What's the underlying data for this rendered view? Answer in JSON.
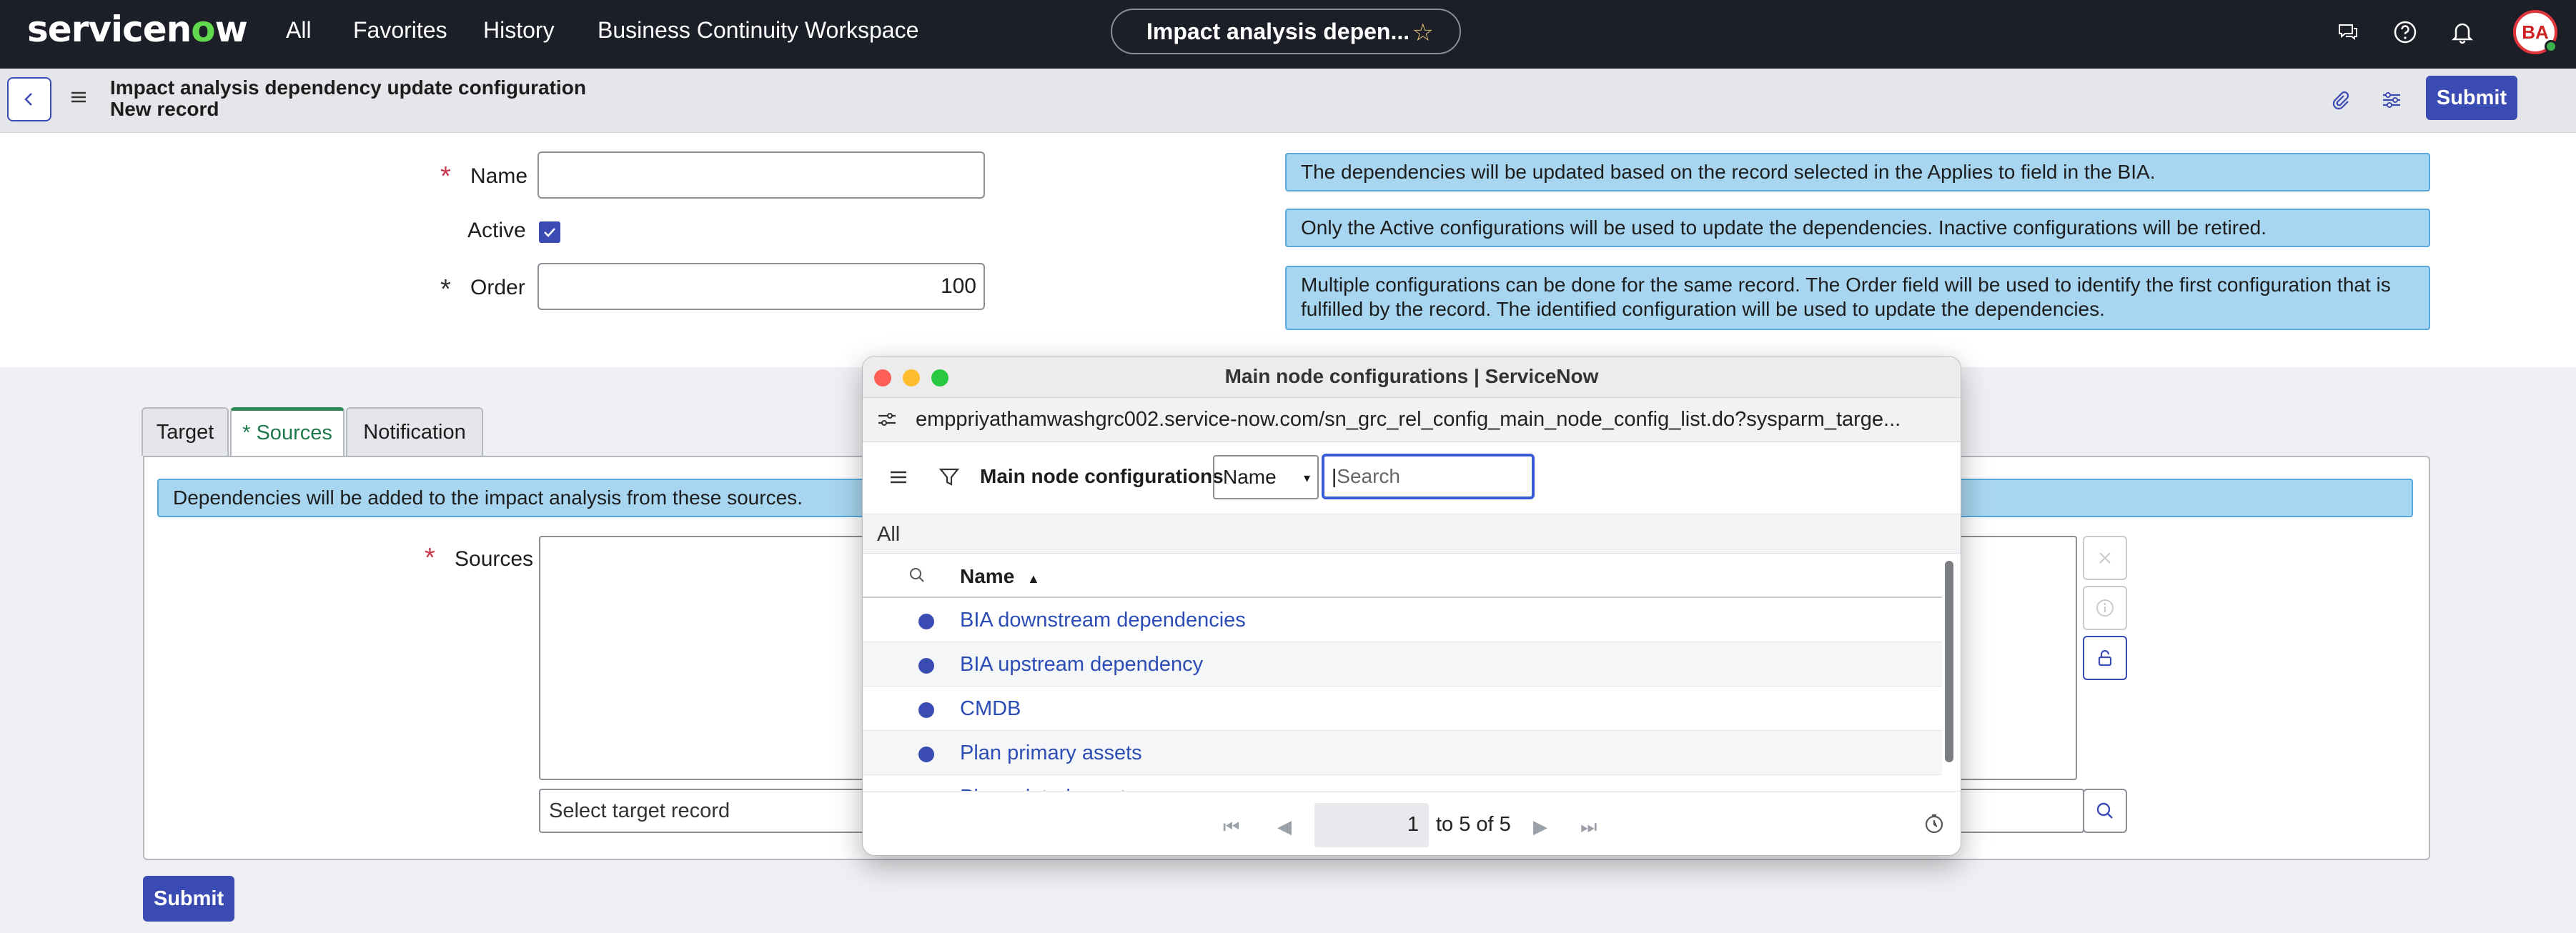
{
  "topnav": {
    "logo": "servicenow",
    "items": [
      "All",
      "Favorites",
      "History",
      "Business Continuity Workspace"
    ],
    "pill_title": "Impact analysis depen...",
    "avatar": "BA"
  },
  "header": {
    "title": "Impact analysis dependency update configuration",
    "subtitle": "New record",
    "submit_label": "Submit"
  },
  "form": {
    "name_label": "Name",
    "name_value": "",
    "active_label": "Active",
    "active_checked": true,
    "order_label": "Order",
    "order_value": "100"
  },
  "info_boxes": [
    "The dependencies will be updated based on the record selected in the Applies to field in the BIA.",
    "Only the Active configurations will be used to update the dependencies. Inactive configurations will be retired.",
    "Multiple configurations can be done for the same record. The Order field will be used to identify the first configuration that is fulfilled by the record. The identified configuration will be used to update the dependencies."
  ],
  "tabs": [
    {
      "label": "Target",
      "active": false
    },
    {
      "label": "* Sources",
      "active": true
    },
    {
      "label": "Notification",
      "active": false
    }
  ],
  "sources_panel": {
    "info": "Dependencies will be added to the impact analysis from these sources.",
    "sources_label": "Sources",
    "target_placeholder": "Select target record"
  },
  "bottom_submit": "Submit",
  "popup": {
    "title": "Main node configurations | ServiceNow",
    "url": "emppriyathamwashgrc002.service-now.com/sn_grc_rel_config_main_node_config_list.do?sysparm_targe...",
    "list_label": "Main node configurations",
    "field_select": "Name",
    "search_placeholder": "Search",
    "all_label": "All",
    "column_header": "Name",
    "sort": "ascending",
    "rows": [
      "BIA downstream dependencies",
      "BIA upstream dependency",
      "CMDB",
      "Plan primary assets",
      "Plan related assets"
    ],
    "page_value": "1",
    "page_text": "to 5 of 5"
  },
  "colors": {
    "nav_bg": "#1c1f27",
    "primary": "#3a4bb3",
    "info_bg": "#a8d5f0",
    "link": "#2b4db5",
    "required": "#c8364c",
    "active_tab": "#2e8b57"
  }
}
